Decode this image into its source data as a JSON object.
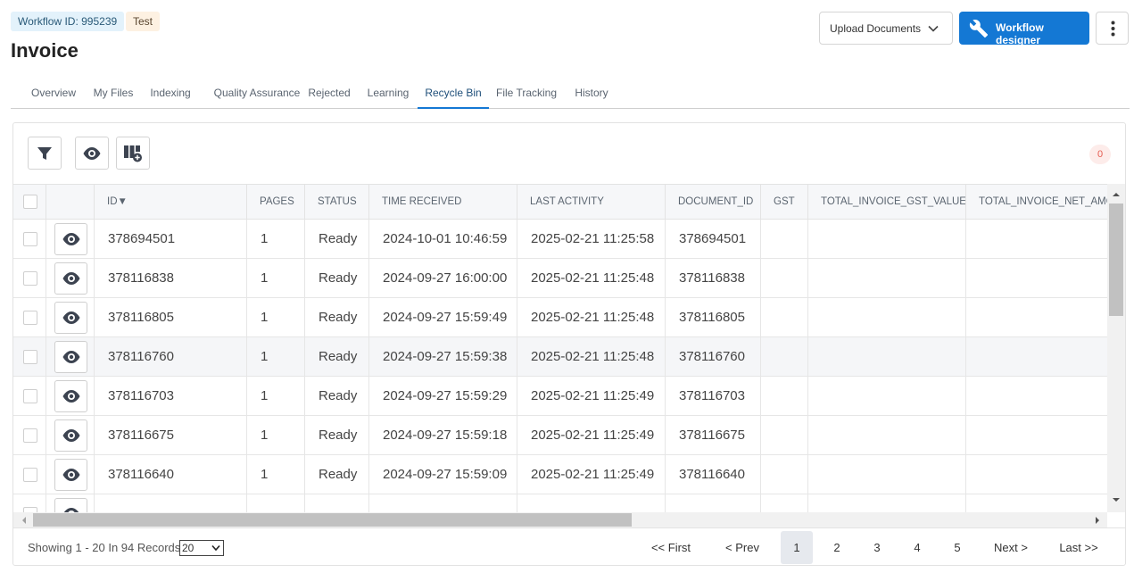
{
  "header": {
    "workflow_badge": "Workflow ID: 995239",
    "env_badge": "Test",
    "title": "Invoice",
    "upload_label": "Upload Documents",
    "designer_label": "Workflow designer"
  },
  "tabs": [
    {
      "label": "Overview"
    },
    {
      "label": "My Files"
    },
    {
      "label": "Indexing"
    },
    {
      "label": "Quality Assurance"
    },
    {
      "label": "Rejected"
    },
    {
      "label": "Learning"
    },
    {
      "label": "Recycle Bin",
      "active": true
    },
    {
      "label": "File Tracking"
    },
    {
      "label": "History"
    }
  ],
  "toolbar": {
    "icons": [
      "filter-icon",
      "eye-icon",
      "column-add-icon"
    ],
    "selected_count": "0"
  },
  "table": {
    "columns": [
      "ID▼",
      "PAGES",
      "STATUS",
      "TIME RECEIVED",
      "LAST ACTIVITY",
      "DOCUMENT_ID",
      "GST",
      "TOTAL_INVOICE_GST_VALUE",
      "TOTAL_INVOICE_NET_AMOU"
    ],
    "rows": [
      {
        "id": "378694501",
        "pages": "1",
        "status": "Ready",
        "time_received": "2024-10-01 10:46:59",
        "last_activity": "2025-02-21 11:25:58",
        "document_id": "378694501"
      },
      {
        "id": "378116838",
        "pages": "1",
        "status": "Ready",
        "time_received": "2024-09-27 16:00:00",
        "last_activity": "2025-02-21 11:25:48",
        "document_id": "378116838"
      },
      {
        "id": "378116805",
        "pages": "1",
        "status": "Ready",
        "time_received": "2024-09-27 15:59:49",
        "last_activity": "2025-02-21 11:25:48",
        "document_id": "378116805"
      },
      {
        "id": "378116760",
        "pages": "1",
        "status": "Ready",
        "time_received": "2024-09-27 15:59:38",
        "last_activity": "2025-02-21 11:25:48",
        "document_id": "378116760"
      },
      {
        "id": "378116703",
        "pages": "1",
        "status": "Ready",
        "time_received": "2024-09-27 15:59:29",
        "last_activity": "2025-02-21 11:25:49",
        "document_id": "378116703"
      },
      {
        "id": "378116675",
        "pages": "1",
        "status": "Ready",
        "time_received": "2024-09-27 15:59:18",
        "last_activity": "2025-02-21 11:25:49",
        "document_id": "378116675"
      },
      {
        "id": "378116640",
        "pages": "1",
        "status": "Ready",
        "time_received": "2024-09-27 15:59:09",
        "last_activity": "2025-02-21 11:25:49",
        "document_id": "378116640"
      }
    ]
  },
  "pagination": {
    "showing": "Showing 1 - 20 In 94 Records",
    "page_size": "20",
    "first": "<< First",
    "prev": "< Prev",
    "pages": [
      "1",
      "2",
      "3",
      "4",
      "5"
    ],
    "current_page": "1",
    "next": "Next >",
    "last": "Last >>"
  },
  "colors": {
    "primary": "#1478d4",
    "badge_info_bg": "#e3f2fb",
    "badge_test_bg": "#fdf1e2",
    "count_badge": "#e55b50"
  }
}
